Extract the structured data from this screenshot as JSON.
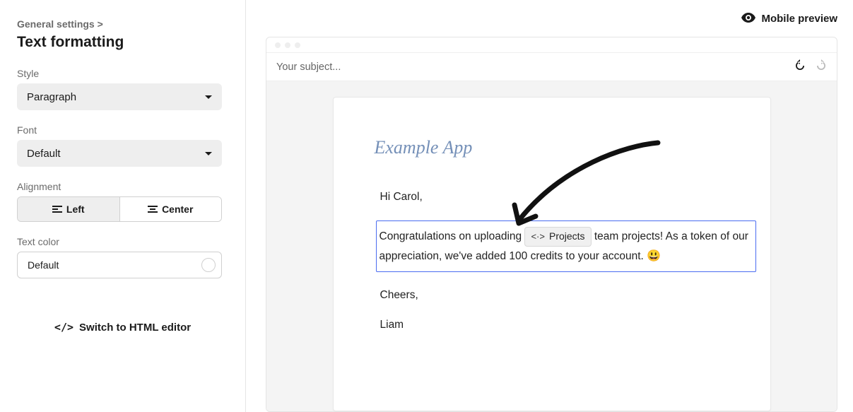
{
  "breadcrumb": "General settings >",
  "panel_title": "Text formatting",
  "style": {
    "label": "Style",
    "value": "Paragraph"
  },
  "font": {
    "label": "Font",
    "value": "Default"
  },
  "alignment": {
    "label": "Alignment",
    "left": "Left",
    "center": "Center"
  },
  "text_color": {
    "label": "Text color",
    "value": "Default"
  },
  "switch_editor": "Switch to HTML editor",
  "mobile_preview": "Mobile preview",
  "subject_placeholder": "Your subject...",
  "email": {
    "app_name": "Example App",
    "greeting": "Hi Carol,",
    "body_pre": "Congratulations on uploading ",
    "chip": "Projects",
    "body_post": " team projects! As a token of our appreciation, we've added 100 credits to your account. ",
    "emoji": "😃",
    "signoff": "Cheers,",
    "sender": "Liam"
  }
}
